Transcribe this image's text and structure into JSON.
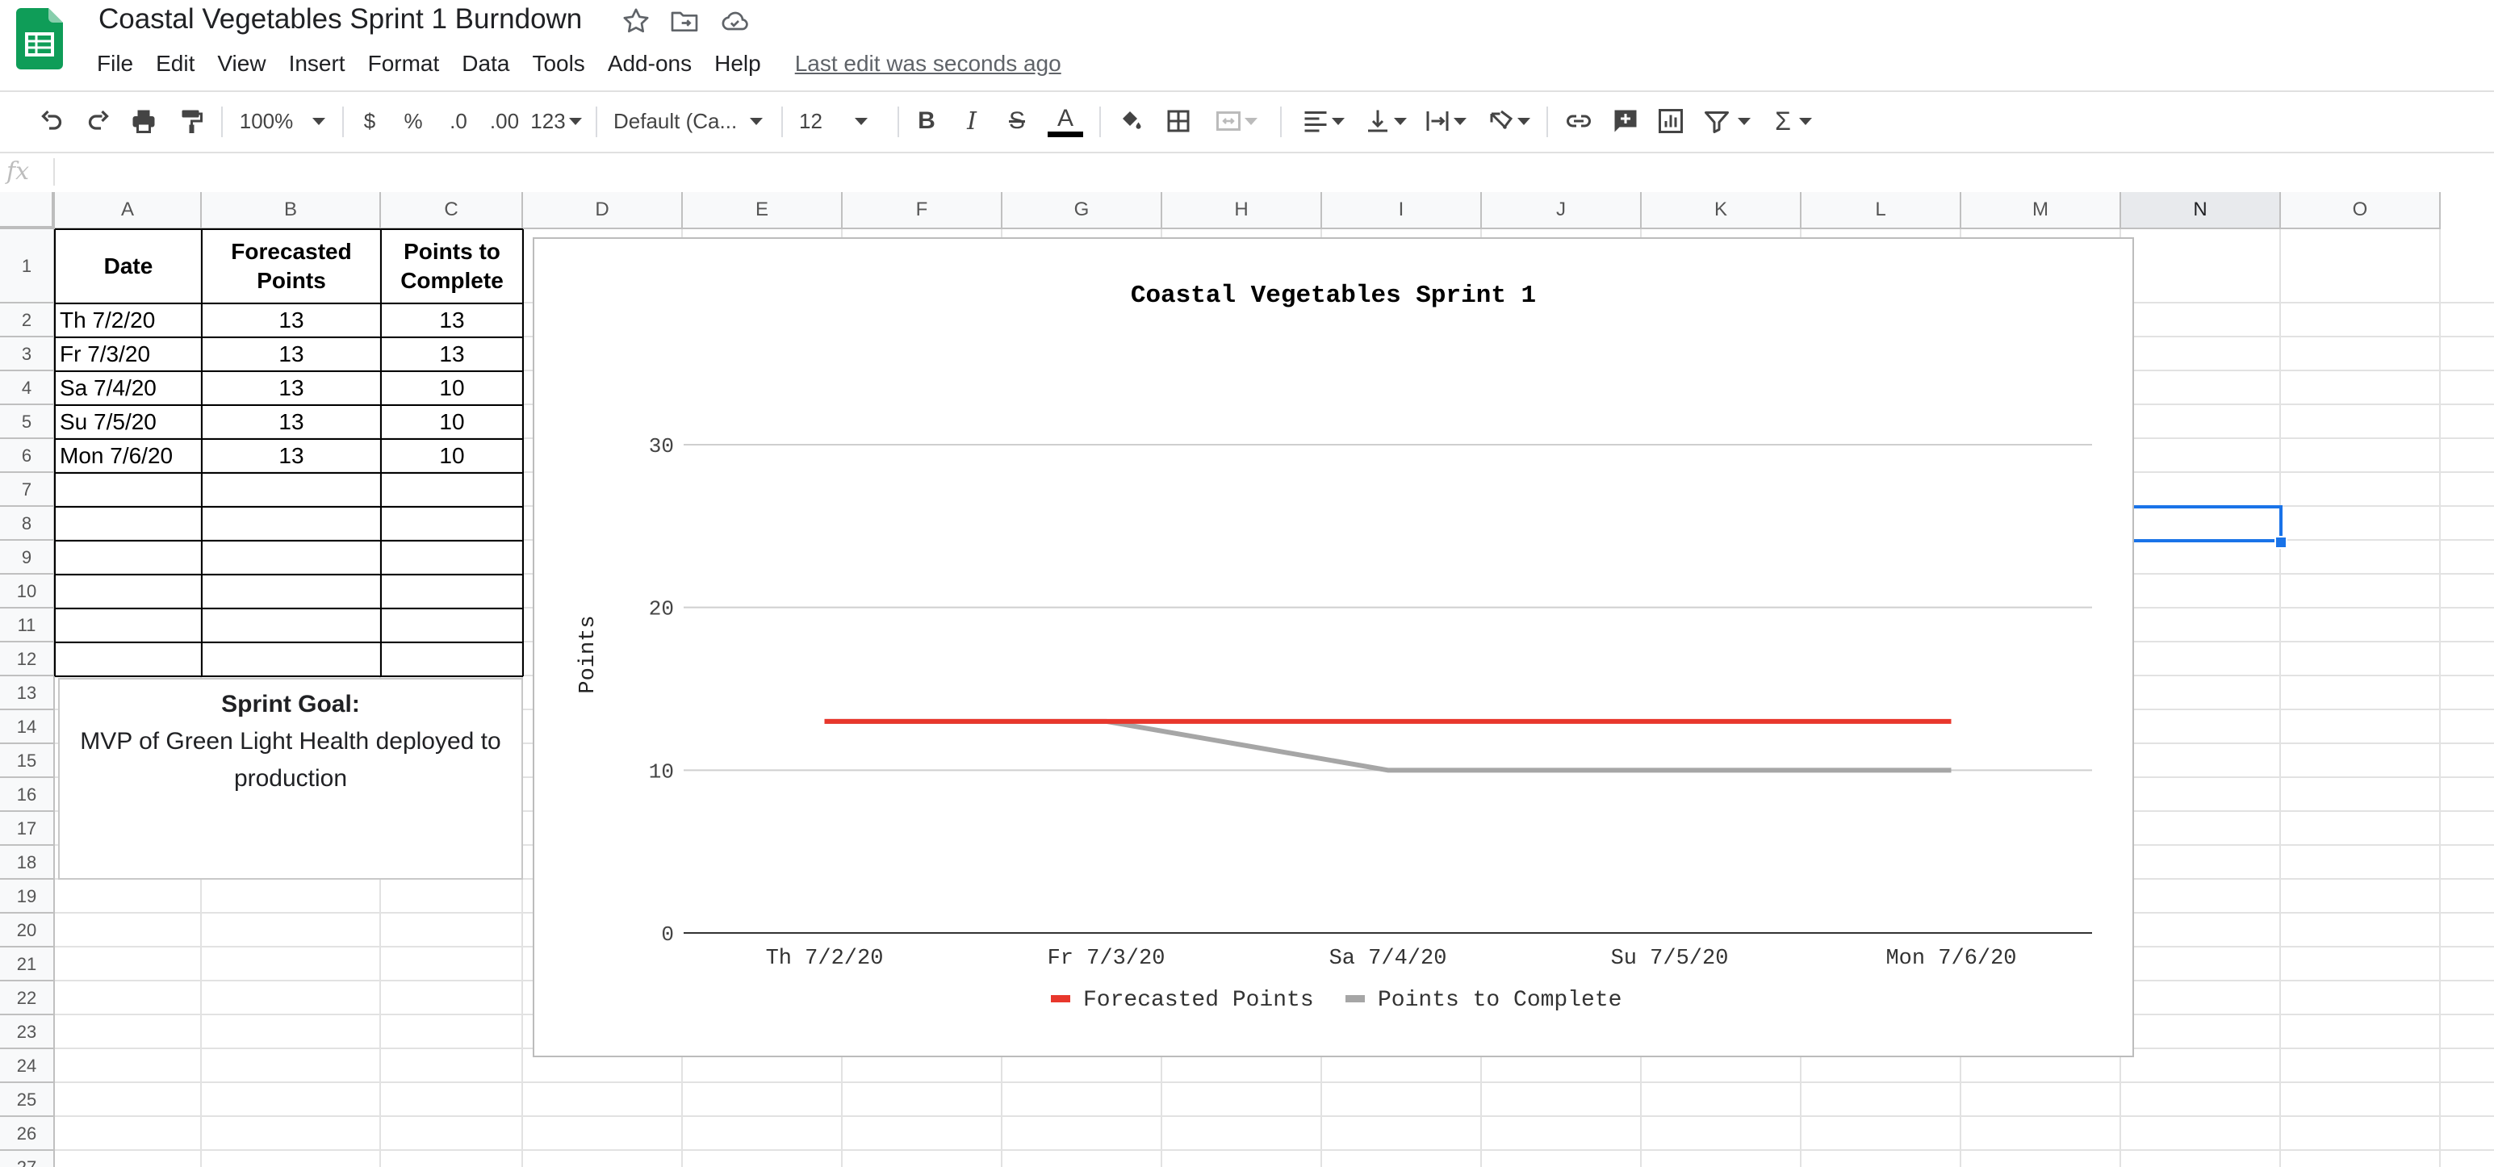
{
  "app": {
    "doc_title": "Coastal Vegetables Sprint 1 Burndown",
    "last_edit": "Last edit was seconds ago",
    "brand_color": "#0f9d58"
  },
  "menu": [
    "File",
    "Edit",
    "View",
    "Insert",
    "Format",
    "Data",
    "Tools",
    "Add-ons",
    "Help"
  ],
  "toolbar": {
    "zoom": "100%",
    "currency": "$",
    "percent": "%",
    "decrease_decimal": ".0",
    "increase_decimal": ".00",
    "more_formats": "123",
    "font": "Default (Ca...",
    "font_size": "12",
    "bold": "B",
    "italic": "I",
    "strikethrough": "S",
    "text_color": "A",
    "sum": "Σ"
  },
  "formula_bar": {
    "fx": "fx",
    "value": ""
  },
  "grid": {
    "columns": [
      "A",
      "B",
      "C",
      "D",
      "E",
      "F",
      "G",
      "H",
      "I",
      "J",
      "K",
      "L",
      "M",
      "N",
      "O"
    ],
    "selected_column": "N",
    "rows": [
      "1",
      "2",
      "3",
      "4",
      "5",
      "6",
      "7",
      "8",
      "9",
      "10",
      "11",
      "12",
      "13",
      "14",
      "15",
      "16",
      "17",
      "18",
      "19",
      "20",
      "21",
      "22",
      "23",
      "24",
      "25",
      "26",
      "27"
    ]
  },
  "table": {
    "headers": [
      "Date",
      "Forecasted Points",
      "Points to Complete"
    ],
    "rows": [
      [
        "Th 7/2/20",
        "13",
        "13"
      ],
      [
        "Fr 7/3/20",
        "13",
        "13"
      ],
      [
        "Sa 7/4/20",
        "13",
        "10"
      ],
      [
        "Su 7/5/20",
        "13",
        "10"
      ],
      [
        "Mon 7/6/20",
        "13",
        "10"
      ]
    ]
  },
  "sprint_goal": {
    "title": "Sprint Goal:",
    "text": "MVP of Green Light Health deployed to production"
  },
  "chart_data": {
    "type": "line",
    "title": "Coastal Vegetables Sprint 1",
    "xlabel": "",
    "ylabel": "Points",
    "categories": [
      "Th 7/2/20",
      "Fr 7/3/20",
      "Sa 7/4/20",
      "Su 7/5/20",
      "Mon 7/6/20"
    ],
    "series": [
      {
        "name": "Forecasted Points",
        "values": [
          13,
          13,
          13,
          13,
          13
        ],
        "color": "#e8372c"
      },
      {
        "name": "Points to Complete",
        "values": [
          13,
          13,
          10,
          10,
          10
        ],
        "color": "#a6a6a6"
      }
    ],
    "ylim": [
      0,
      30
    ],
    "yticks": [
      0,
      10,
      20,
      30
    ],
    "grid": true,
    "legend": "bottom"
  }
}
